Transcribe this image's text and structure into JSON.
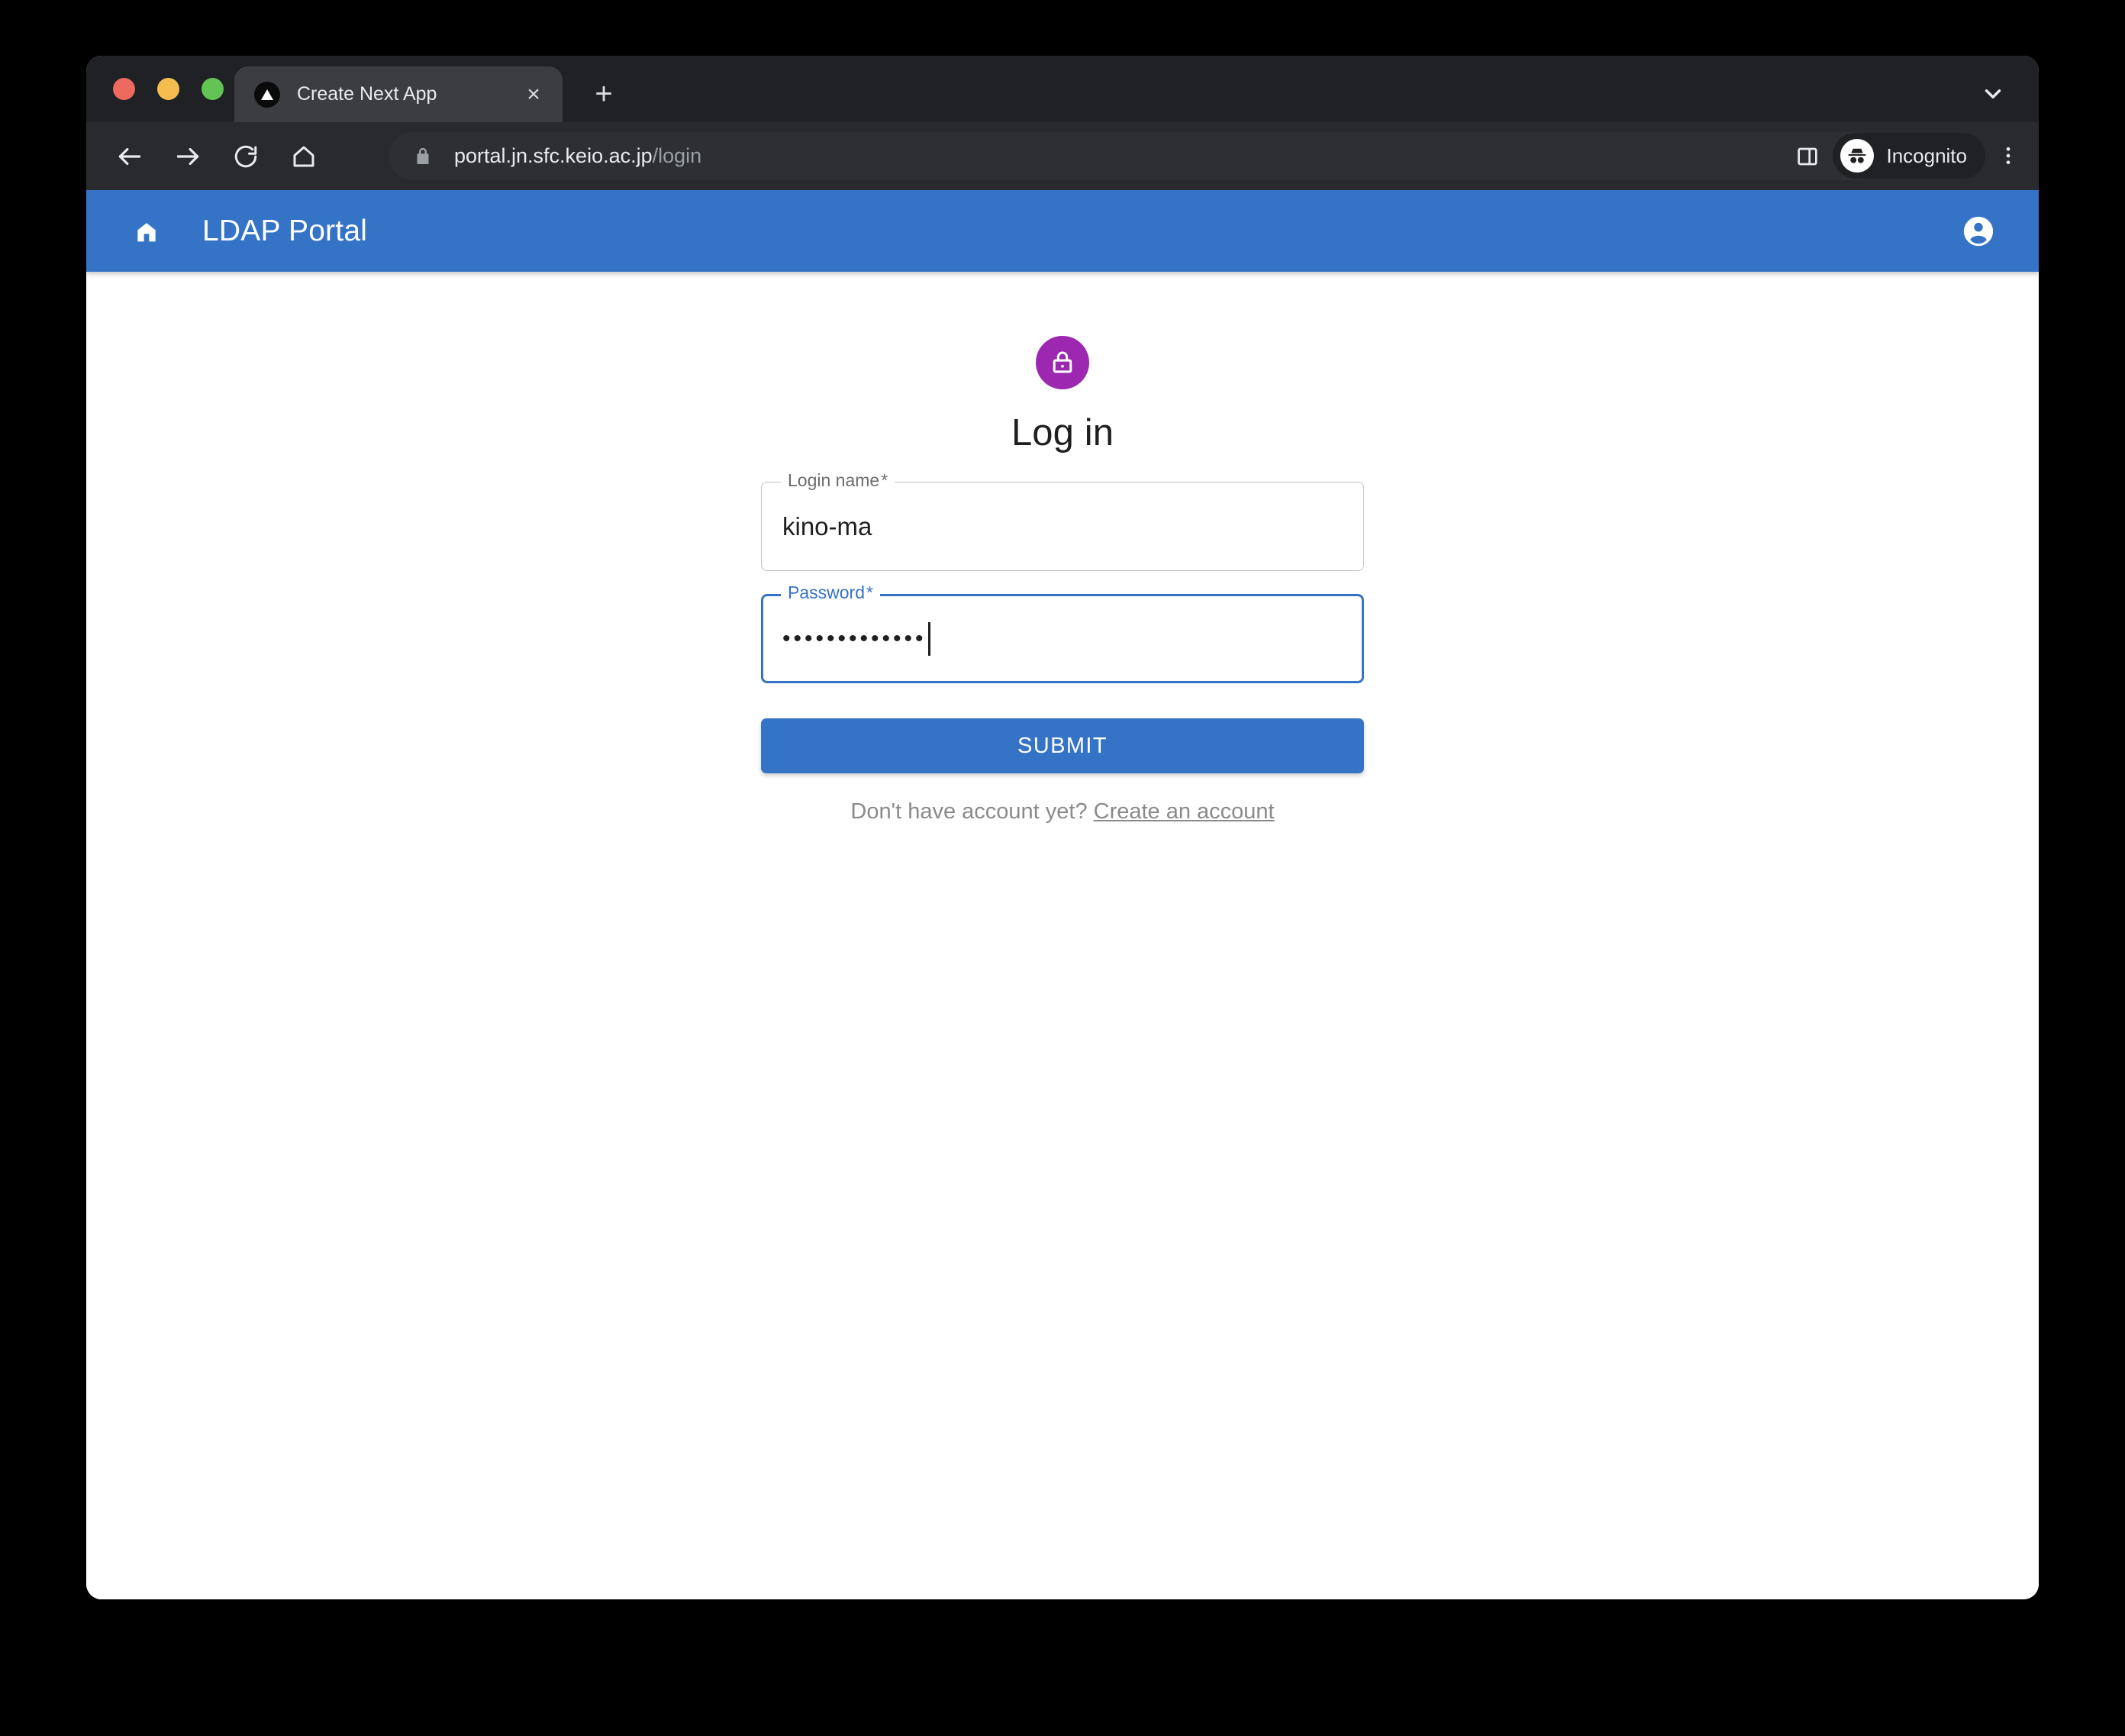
{
  "window": {
    "traffic_lights": [
      {
        "name": "close",
        "color": "#ed6a5e"
      },
      {
        "name": "minimize",
        "color": "#f5bd4f"
      },
      {
        "name": "maximize",
        "color": "#61c454"
      }
    ]
  },
  "browser": {
    "tab": {
      "title": "Create Next App",
      "favicon": "nextjs-triangle-icon",
      "close_label": "×"
    },
    "new_tab_label": "+",
    "tab_search_icon": "chevron-down-icon",
    "nav": {
      "back_icon": "arrow-left-icon",
      "forward_icon": "arrow-right-icon",
      "reload_icon": "reload-icon",
      "home_icon": "home-icon"
    },
    "omnibox": {
      "security_icon": "lock-icon",
      "url_host": "portal.jn.sfc.keio.ac.jp",
      "url_path": "/login",
      "bookmark_icon": "star-icon"
    },
    "side_panel_icon": "side-panel-icon",
    "profile": {
      "label": "Incognito",
      "icon": "incognito-icon"
    },
    "menu_icon": "three-dot-menu-icon"
  },
  "app": {
    "bar": {
      "home_icon": "home-icon",
      "title": "LDAP Portal",
      "account_icon": "account-circle-icon",
      "background_color": "#3573c6"
    },
    "login": {
      "avatar_icon": "lock-outlined-icon",
      "avatar_color": "#9c27b0",
      "heading": "Log in",
      "fields": [
        {
          "name": "login-name",
          "label": "Login name",
          "required_marker": "*",
          "value": "kino-ma",
          "focused": false
        },
        {
          "name": "password",
          "label": "Password",
          "required_marker": "*",
          "value": "•••••••••••••",
          "focused": true
        }
      ],
      "submit_label": "SUBMIT",
      "signup_prompt": "Don't have account yet?",
      "signup_link_label": "Create an account",
      "accent_color": "#3573c6"
    }
  }
}
